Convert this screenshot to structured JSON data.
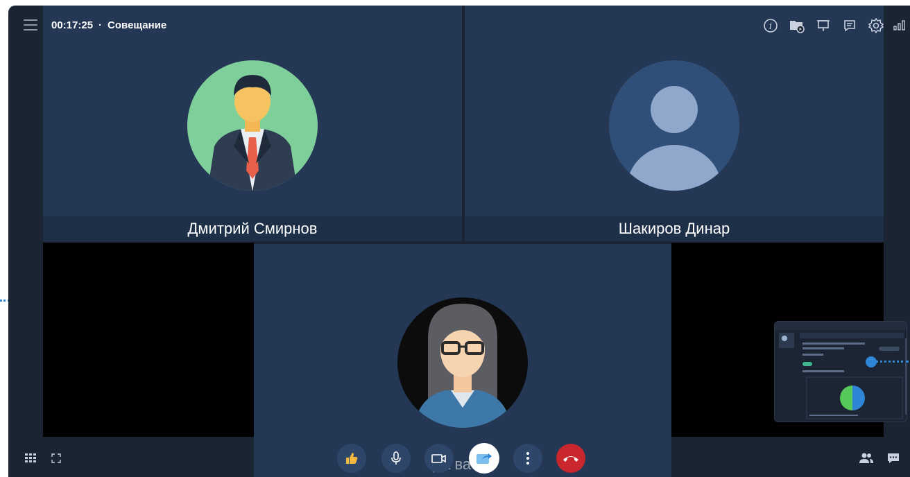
{
  "header": {
    "timer": "00:17:25",
    "separator": "·",
    "meeting_title": "Совещание",
    "icons": [
      "info-icon",
      "folder-record-icon",
      "screen-share-icon",
      "chat-bubble-icon",
      "settings-icon",
      "signal-icon"
    ]
  },
  "participants": [
    {
      "name": "Дмитрий Смирнов",
      "avatar": "man-in-suit-avatar"
    },
    {
      "name": "Шакиров Динар",
      "avatar": "default-user-avatar"
    },
    {
      "name": "Давыдова Дарья",
      "avatar": "woman-with-glasses-avatar",
      "label_partial": "да ва ар"
    }
  ],
  "controls": {
    "left": [
      "grid-view-icon",
      "fullscreen-icon"
    ],
    "center": [
      "thumbs-up",
      "microphone",
      "camera",
      "share-screen",
      "more-options",
      "end-call"
    ],
    "right": [
      "participants-icon",
      "chat-icon"
    ]
  },
  "colors": {
    "accent": "#2f86d6",
    "end_call": "#c9272d",
    "tile_bg": "#243755",
    "app_bg": "#1a2433"
  }
}
